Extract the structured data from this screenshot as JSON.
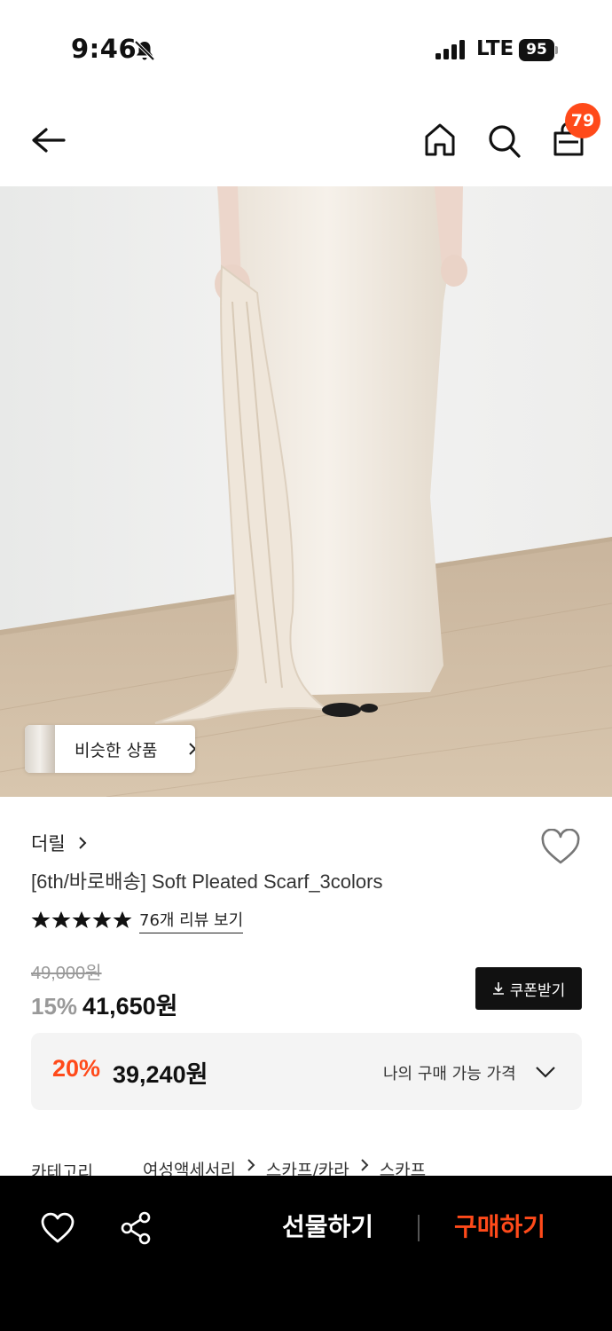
{
  "status_bar": {
    "time": "9:46",
    "network": "LTE",
    "battery": "95"
  },
  "header": {
    "cart_count": "79"
  },
  "gallery": {
    "similar_label": "비슷한 상품"
  },
  "product": {
    "brand": "더릴",
    "title": "[6th/바로배송] Soft Pleated Scarf_3colors",
    "rating_stars": 5,
    "review_link": "76개 리뷰 보기",
    "original_price": "49,000원",
    "discount_rate": "15%",
    "sale_price": "41,650원",
    "coupon_label": "쿠폰받기"
  },
  "my_price": {
    "rate": "20%",
    "price": "39,240원",
    "label": "나의 구매 가능 가격"
  },
  "category": {
    "label": "카테고리",
    "path": [
      "여성액세서리",
      "스카프/카라",
      "스카프"
    ]
  },
  "bottom_bar": {
    "gift_label": "선물하기",
    "buy_label": "구매하기"
  },
  "colors": {
    "accent": "#ff4a1a",
    "bar_background": "#000000"
  },
  "icons": [
    "bell-slash-icon",
    "signal-icon",
    "battery-icon",
    "back-arrow-icon",
    "home-icon",
    "search-icon",
    "shopping-bag-icon",
    "chevron-right-icon",
    "heart-icon",
    "star-icon",
    "download-icon",
    "chevron-down-icon",
    "share-icon"
  ]
}
